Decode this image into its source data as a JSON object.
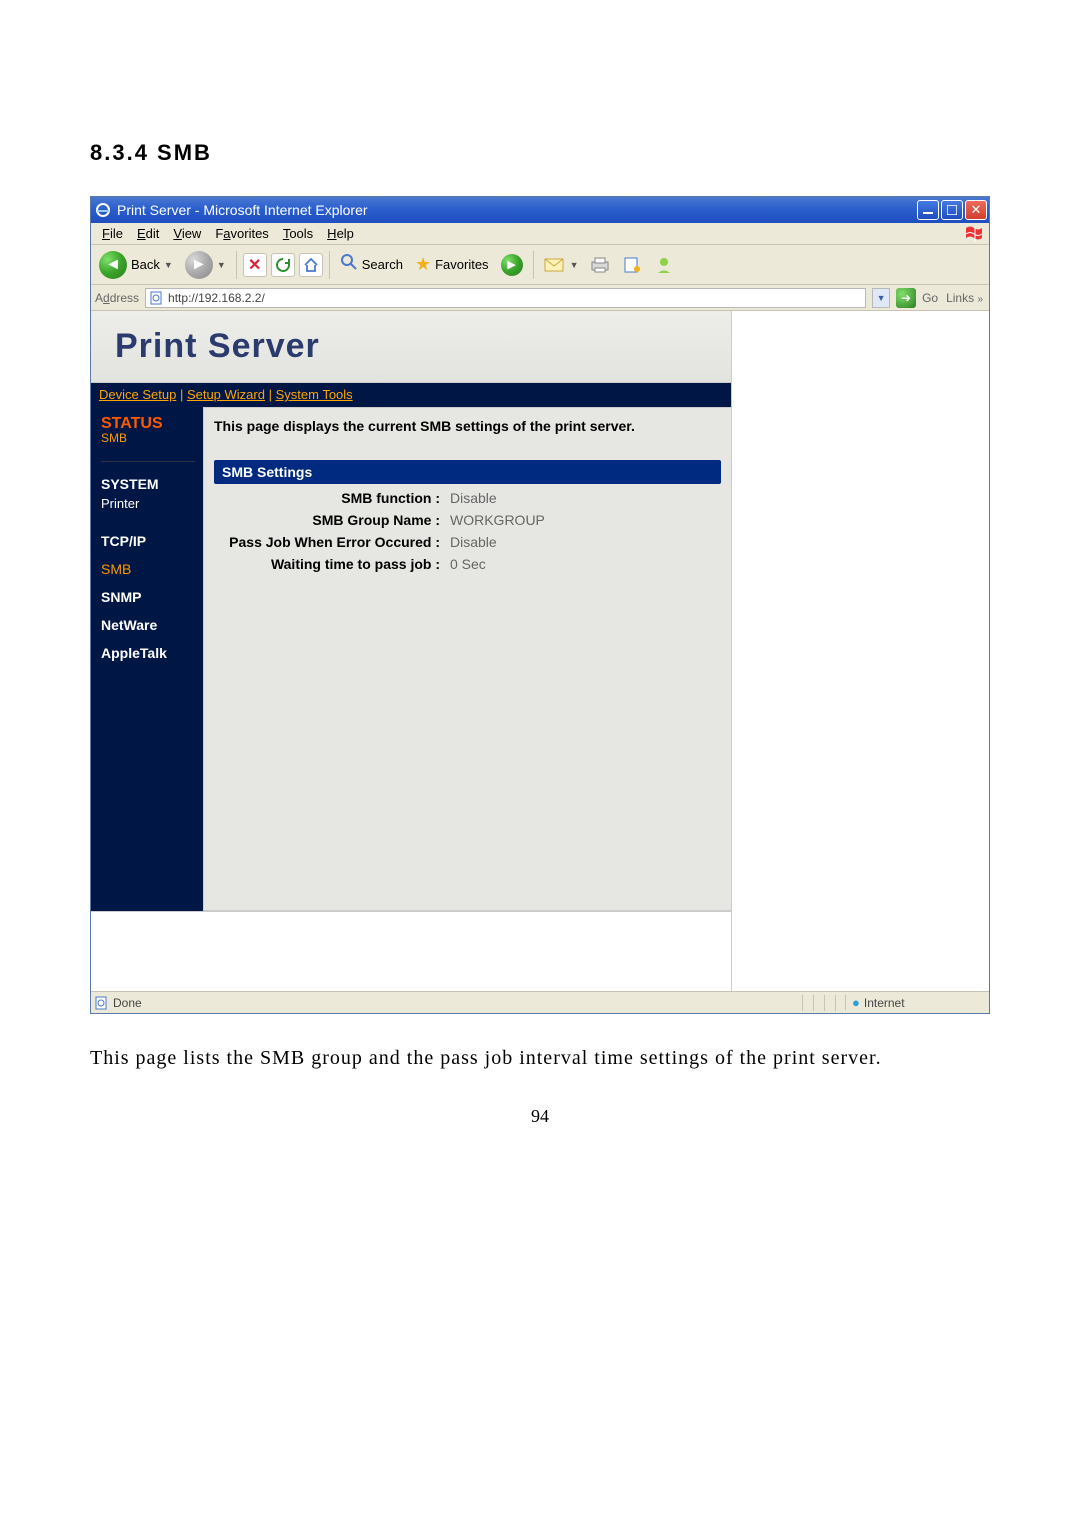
{
  "doc": {
    "heading": "8.3.4   SMB",
    "body_text": "This page lists the SMB group and the pass job interval time settings of the print server.",
    "page_number": "94"
  },
  "titlebar": {
    "title": "Print Server - Microsoft Internet Explorer"
  },
  "menubar": {
    "items": [
      {
        "pre": "",
        "u": "F",
        "post": "ile"
      },
      {
        "pre": "",
        "u": "E",
        "post": "dit"
      },
      {
        "pre": "",
        "u": "V",
        "post": "iew"
      },
      {
        "pre": "F",
        "u": "a",
        "post": "vorites"
      },
      {
        "pre": "",
        "u": "T",
        "post": "ools"
      },
      {
        "pre": "",
        "u": "H",
        "post": "elp"
      }
    ]
  },
  "toolbar": {
    "back_label": "Back",
    "search_label": "Search",
    "favorites_label": "Favorites"
  },
  "addressbar": {
    "label": "Address",
    "url": "http://192.168.2.2/",
    "go_label": "Go",
    "links_label": "Links"
  },
  "banner": {
    "title": "Print Server"
  },
  "navlinks": {
    "items": [
      "Device Setup",
      "Setup Wizard",
      "System Tools"
    ],
    "separator": " | "
  },
  "sidebar": {
    "status_label": "STATUS",
    "status_sub": "SMB",
    "items": [
      "SYSTEM",
      "Printer",
      "TCP/IP",
      "SMB",
      "SNMP",
      "NetWare",
      "AppleTalk"
    ]
  },
  "panel": {
    "intro": "This page displays the current SMB settings of the print server.",
    "settings_header": "SMB Settings",
    "rows": [
      {
        "k": "SMB function :",
        "v": "Disable"
      },
      {
        "k": "SMB Group Name :",
        "v": "WORKGROUP"
      },
      {
        "k": "Pass Job When Error Occured :",
        "v": "Disable"
      },
      {
        "k": "Waiting time to pass job :",
        "v": "0 Sec"
      }
    ]
  },
  "statusbar": {
    "done": "Done",
    "zone": "Internet"
  },
  "colors": {
    "accent_orange": "#fc5a00",
    "sidebar_bg": "#001746"
  }
}
